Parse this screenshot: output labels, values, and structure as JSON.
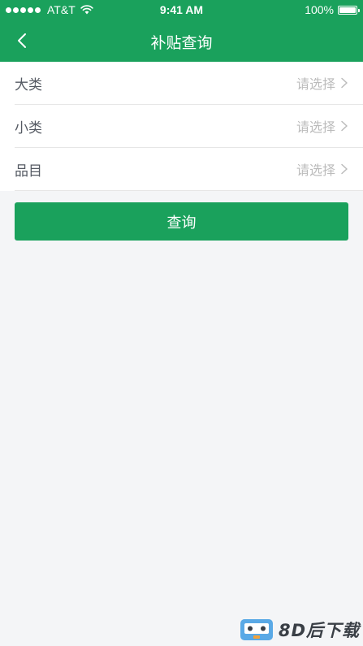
{
  "status_bar": {
    "carrier": "AT&T",
    "time": "9:41 AM",
    "battery": "100%",
    "battery_level": 1.0
  },
  "nav": {
    "title": "补贴查询",
    "back_icon": "chevron-left-icon"
  },
  "form": {
    "rows": [
      {
        "label": "大类",
        "placeholder": "请选择"
      },
      {
        "label": "小类",
        "placeholder": "请选择"
      },
      {
        "label": "品目",
        "placeholder": "请选择"
      }
    ]
  },
  "query_button": {
    "label": "查询"
  },
  "watermark": {
    "text": "8D后下载"
  },
  "colors": {
    "brand_green": "#1aa15c",
    "page_background": "#f4f5f7",
    "label_text": "#555a63",
    "placeholder_text": "#bbbbbb"
  }
}
